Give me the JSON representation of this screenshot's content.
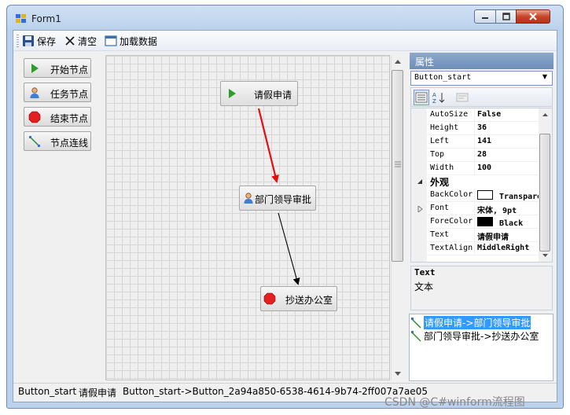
{
  "window": {
    "title": "Form1"
  },
  "toolbar": {
    "save_label": "保存",
    "clear_label": "清空",
    "load_label": "加载数据"
  },
  "node_buttons": {
    "start": "开始节点",
    "task": "任务节点",
    "end": "结束节点",
    "connect": "节点连线"
  },
  "canvas": {
    "nodes": [
      {
        "id": "start",
        "text": "请假申请",
        "icon": "play-icon"
      },
      {
        "id": "task",
        "text": "部门领导审批",
        "icon": "user-icon"
      },
      {
        "id": "end",
        "text": "抄送办公室",
        "icon": "stop-icon"
      }
    ]
  },
  "properties": {
    "header": "属性",
    "selected_object": "Button_start",
    "rows": [
      {
        "name": "AutoSize",
        "value": "False"
      },
      {
        "name": "Height",
        "value": "36"
      },
      {
        "name": "Left",
        "value": "141"
      },
      {
        "name": "Top",
        "value": "28"
      },
      {
        "name": "Width",
        "value": "100"
      }
    ],
    "category_appearance": "外观",
    "appearance_rows": [
      {
        "name": "BackColor",
        "value": "Transparent",
        "swatch": "#ffffff"
      },
      {
        "name": "Font",
        "value": "宋体, 9pt"
      },
      {
        "name": "ForeColor",
        "value": "Black",
        "swatch": "#000000"
      },
      {
        "name": "Text",
        "value": "请假申请"
      },
      {
        "name": "TextAlign",
        "value": "MiddleRight"
      }
    ],
    "description": {
      "title": "Text",
      "text": "文本"
    }
  },
  "links": [
    {
      "text": "请假申请->部门领导审批",
      "selected": true
    },
    {
      "text": "部门领导审批->抄送办公室",
      "selected": false
    }
  ],
  "status": {
    "name": "Button_start",
    "text": "请假申请",
    "link": "Button_start->Button_2a94a850-6538-4614-9b74-2ff007a7ae05"
  },
  "watermark": "CSDN @C#winform流程图",
  "colors": {
    "selected_link_bg": "#3399ff",
    "red_arrow": "#e01010",
    "property_header": "#7f9cc4"
  }
}
